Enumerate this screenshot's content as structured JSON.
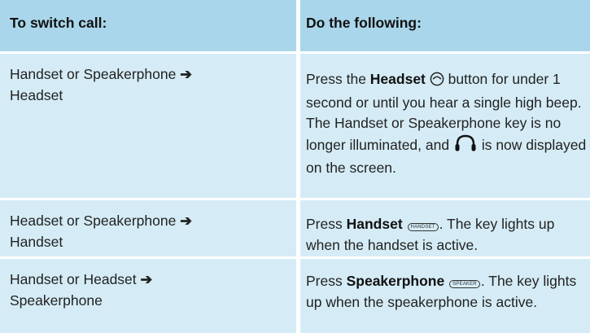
{
  "table": {
    "headers": [
      "To switch call:",
      "Do the following:"
    ],
    "rows": [
      {
        "from_to_line1": "Handset or Speakerphone",
        "arrow": "➔",
        "from_to_line2": "Headset",
        "action": {
          "prefix": "Press the ",
          "bold": "Headset",
          "icon": "headset-button-icon",
          "after_icon": " button for under 1 second or until you hear a single high beep. The Handset or Speakerphone key is no longer illuminated, and ",
          "icon2": "headset-status-icon",
          "suffix": " is now displayed on the screen."
        }
      },
      {
        "from_to_line1": "Headset or Speakerphone",
        "arrow": "➔",
        "from_to_line2": "Handset",
        "action": {
          "prefix": "Press ",
          "bold": "Handset",
          "key_label": "HANDSET",
          "suffix": ". The key lights up when the handset is active."
        }
      },
      {
        "from_to_line1": "Handset or Headset",
        "arrow": "➔",
        "from_to_line2": "Speakerphone",
        "action": {
          "prefix": "Press ",
          "bold": "Speakerphone",
          "key_label": "SPEAKER",
          "suffix": ". The key lights up when the speakerphone is active."
        }
      }
    ]
  },
  "colors": {
    "header_bg": "#a9d6ea",
    "row_bg": "#d5ecf6",
    "text": "#222222"
  }
}
